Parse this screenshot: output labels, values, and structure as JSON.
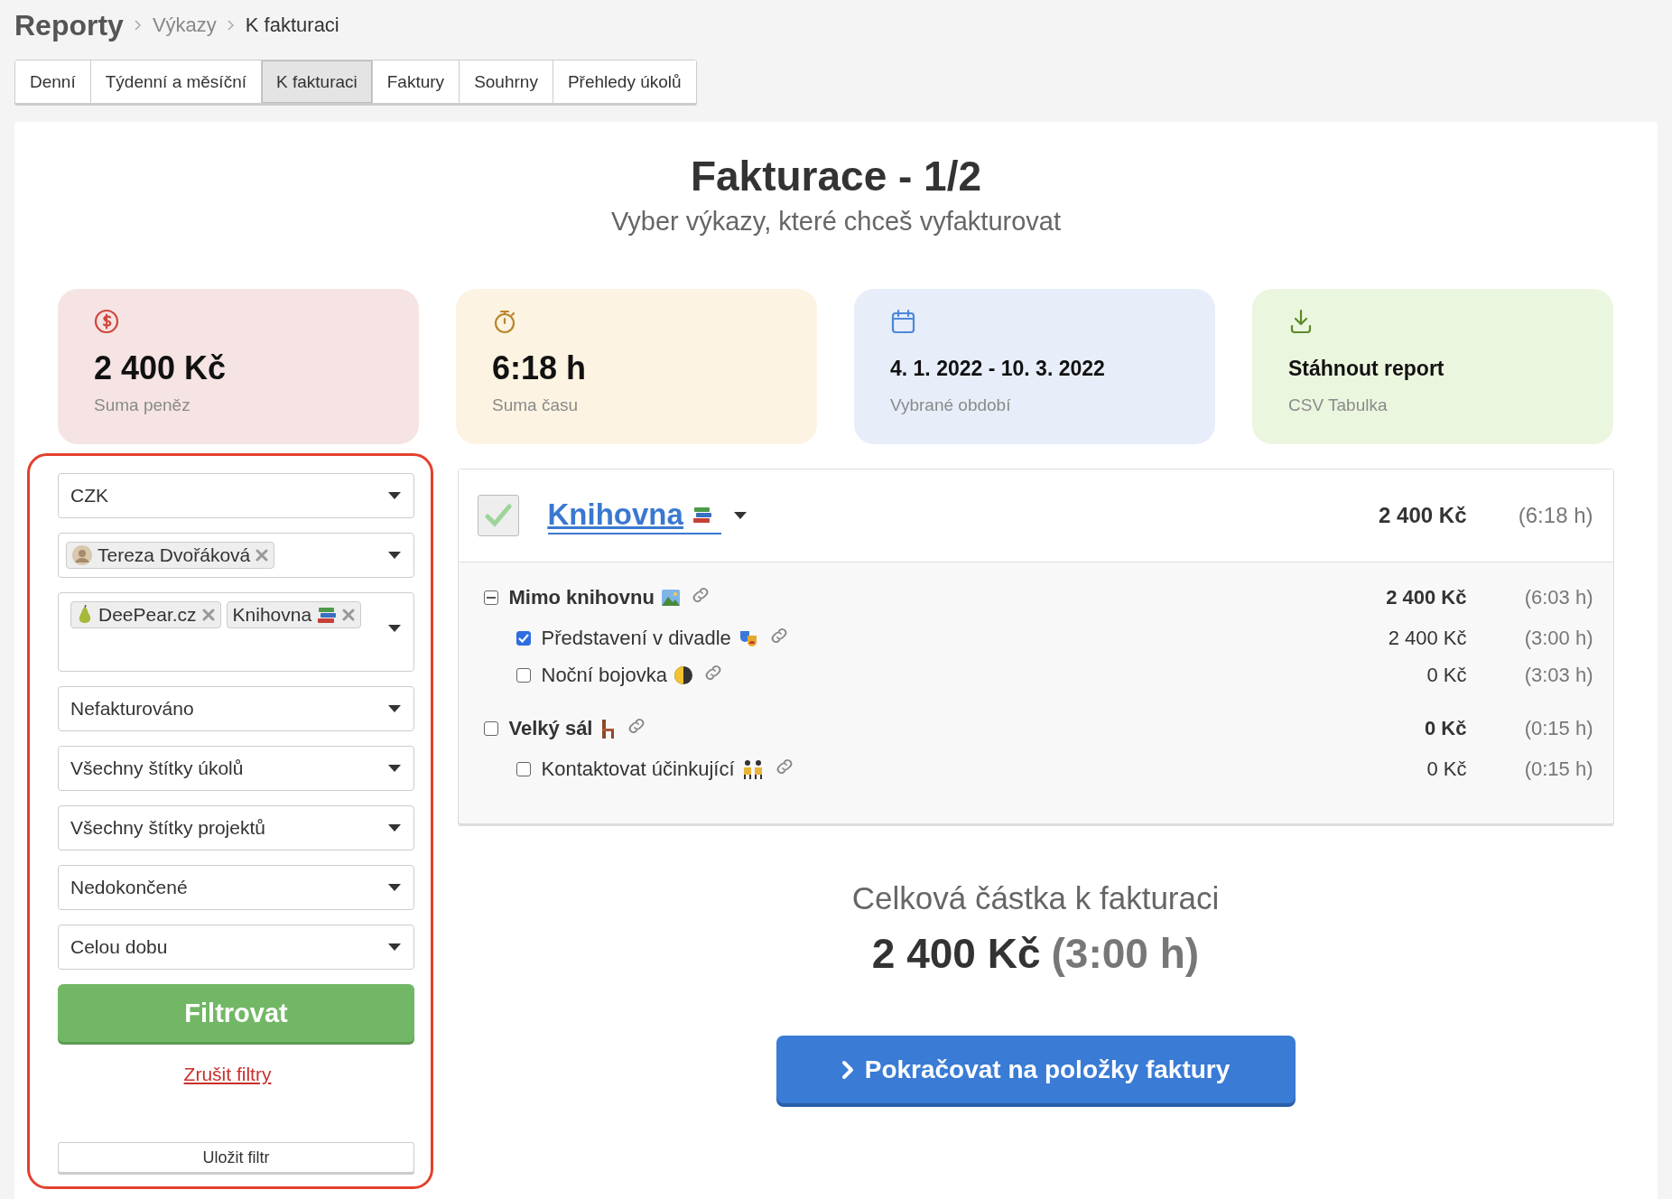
{
  "breadcrumb": [
    {
      "label": "Reporty",
      "kind": "root"
    },
    {
      "label": "Výkazy",
      "kind": "link"
    },
    {
      "label": "K fakturaci",
      "kind": "current"
    }
  ],
  "tabs": [
    {
      "label": "Denní",
      "selected": false
    },
    {
      "label": "Týdenní a měsíční",
      "selected": false
    },
    {
      "label": "K fakturaci",
      "selected": true
    },
    {
      "label": "Faktury",
      "selected": false
    },
    {
      "label": "Souhrny",
      "selected": false
    },
    {
      "label": "Přehledy úkolů",
      "selected": false
    }
  ],
  "heading": {
    "title": "Fakturace - 1/2",
    "subtitle": "Vyber výkazy, které chceš vyfakturovat"
  },
  "stats": [
    {
      "kind": "money",
      "value": "2 400 Kč",
      "label": "Suma peněz"
    },
    {
      "kind": "time",
      "value": "6:18 h",
      "label": "Suma času"
    },
    {
      "kind": "period",
      "value": "4. 1. 2022 - 10. 3. 2022",
      "label": "Vybrané období"
    },
    {
      "kind": "download",
      "value": "Stáhnout report",
      "label": "CSV Tabulka"
    }
  ],
  "filters": {
    "selects": [
      {
        "kind": "single",
        "value": "CZK"
      },
      {
        "kind": "tags",
        "tags": [
          {
            "label": "Tereza Dvořáková",
            "kind": "person"
          }
        ]
      },
      {
        "kind": "tags",
        "tags": [
          {
            "label": "DeePear.cz",
            "kind": "client"
          },
          {
            "label": "Knihovna",
            "kind": "project"
          }
        ]
      },
      {
        "kind": "single",
        "value": "Nefakturováno"
      },
      {
        "kind": "single",
        "value": "Všechny štítky úkolů"
      },
      {
        "kind": "single",
        "value": "Všechny štítky projektů"
      },
      {
        "kind": "single",
        "value": "Nedokončené"
      },
      {
        "kind": "single",
        "value": "Celou dobu"
      }
    ],
    "filter_button": "Filtrovat",
    "clear_link": "Zrušit filtry",
    "save_button": "Uložit filtr"
  },
  "project": {
    "name": "Knihovna",
    "checked": true,
    "amount": "2 400 Kč",
    "time": "(6:18 h)",
    "groups": [
      {
        "name": "Mimo knihovnu",
        "indeterminate": true,
        "amount": "2 400 Kč",
        "time": "(6:03 h)",
        "children": [
          {
            "name": "Představení v divadle",
            "checked": true,
            "amount": "2 400 Kč",
            "time": "(3:00 h)"
          },
          {
            "name": "Noční bojovka",
            "checked": false,
            "amount": "0 Kč",
            "time": "(3:03 h)"
          }
        ]
      },
      {
        "name": "Velký sál",
        "indeterminate": false,
        "amount": "0 Kč",
        "time": "(0:15 h)",
        "children": [
          {
            "name": "Kontaktovat účinkující",
            "checked": false,
            "amount": "0 Kč",
            "time": "(0:15 h)"
          }
        ]
      }
    ]
  },
  "total": {
    "label": "Celková částka k fakturaci",
    "amount": "2 400 Kč",
    "time": "(3:00 h)"
  },
  "continue_button": "Pokračovat na položky faktury"
}
